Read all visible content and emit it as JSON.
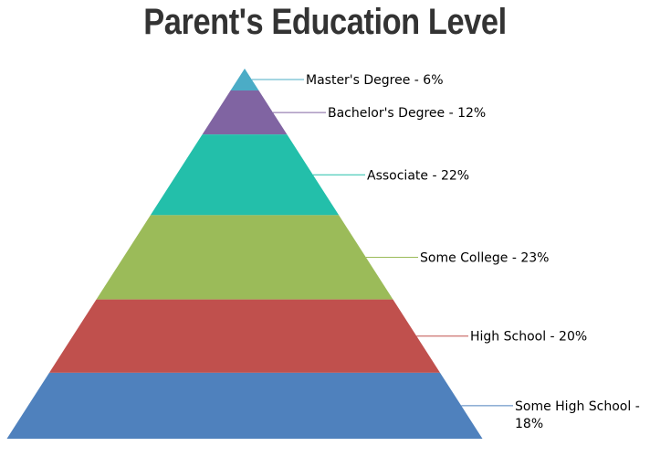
{
  "chart_data": {
    "type": "pyramid",
    "title": "Parent's Education Level",
    "segments": [
      {
        "name": "Master's Degree",
        "value": 6,
        "label": "Master's Degree - 6%",
        "color": "#4BACC6"
      },
      {
        "name": "Bachelor's Degree",
        "value": 12,
        "label": "Bachelor's Degree - 12%",
        "color": "#8064A2"
      },
      {
        "name": "Associate",
        "value": 22,
        "label": "Associate - 22%",
        "color": "#23BFAA"
      },
      {
        "name": "Some College",
        "value": 23,
        "label": "Some College - 23%",
        "color": "#9BBB59"
      },
      {
        "name": "High School",
        "value": 20,
        "label": "High School - 20%",
        "color": "#C0504D"
      },
      {
        "name": "Some High School",
        "value": 18,
        "label_lines": [
          "Some High School -",
          "18%"
        ],
        "color": "#4F81BD"
      }
    ]
  }
}
